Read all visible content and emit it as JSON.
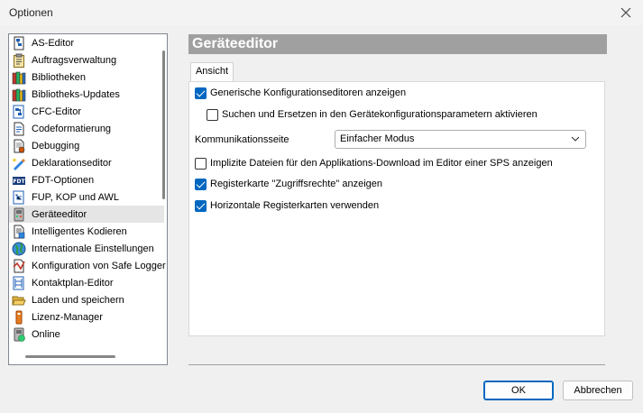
{
  "window": {
    "title": "Optionen"
  },
  "tree": {
    "selected_index": 10,
    "items": [
      {
        "label": "AS-Editor",
        "icon": "as-editor-icon"
      },
      {
        "label": "Auftragsverwaltung",
        "icon": "clipboard-icon"
      },
      {
        "label": "Bibliotheken",
        "icon": "library-books-icon"
      },
      {
        "label": "Bibliotheks-Updates",
        "icon": "library-books-icon"
      },
      {
        "label": "CFC-Editor",
        "icon": "cfc-editor-icon"
      },
      {
        "label": "Codeformatierung",
        "icon": "document-icon"
      },
      {
        "label": "Debugging",
        "icon": "debug-icon"
      },
      {
        "label": "Deklarationseditor",
        "icon": "declaration-editor-icon"
      },
      {
        "label": "FDT-Optionen",
        "icon": "fdt-icon"
      },
      {
        "label": "FUP, KOP und AWL",
        "icon": "network-editor-icon"
      },
      {
        "label": "Geräteeditor",
        "icon": "device-icon"
      },
      {
        "label": "Intelligentes Kodieren",
        "icon": "smart-coding-icon"
      },
      {
        "label": "Internationale Einstellungen",
        "icon": "globe-icon"
      },
      {
        "label": "Konfiguration von Safe Logger",
        "icon": "safe-logger-icon"
      },
      {
        "label": "Kontaktplan-Editor",
        "icon": "ladder-editor-icon"
      },
      {
        "label": "Laden und speichern",
        "icon": "folder-open-icon"
      },
      {
        "label": "Lizenz-Manager",
        "icon": "license-icon"
      },
      {
        "label": "Online",
        "icon": "online-icon"
      }
    ]
  },
  "header": {
    "title": "Geräteeditor"
  },
  "tabs": [
    {
      "label": "Ansicht"
    }
  ],
  "options": {
    "generic_editors": {
      "label": "Generische Konfigurationseditoren anzeigen",
      "checked": true
    },
    "search_replace": {
      "label": "Suchen und Ersetzen in den Gerätekonfigurationsparametern aktivieren",
      "checked": false
    },
    "comm_page": {
      "label": "Kommunikationsseite",
      "value": "Einfacher Modus"
    },
    "implicit_files": {
      "label": "Implizite Dateien für den Applikations-Download im Editor einer SPS anzeigen",
      "checked": false
    },
    "access_rights": {
      "label": "Registerkarte \"Zugriffsrechte\" anzeigen",
      "checked": true
    },
    "horizontal_tabs": {
      "label": "Horizontale Registerkarten verwenden",
      "checked": true
    }
  },
  "buttons": {
    "ok": "OK",
    "cancel": "Abbrechen"
  },
  "colors": {
    "accent": "#0067c0",
    "header_bg": "#a0a0a0",
    "selection_bg": "#e5e5e5"
  }
}
